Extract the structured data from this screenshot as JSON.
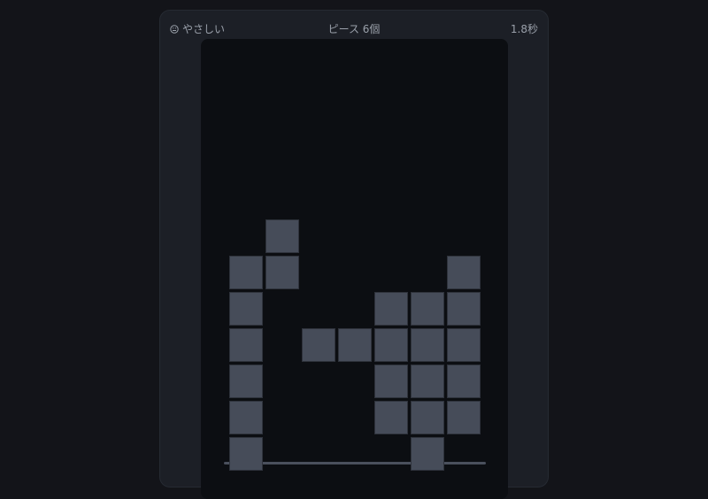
{
  "header": {
    "difficulty_icon": "neutral-face-icon",
    "difficulty_label": "やさしい",
    "piece_count_label": "ピース 6個",
    "timer_label": "1.8秒"
  },
  "colors": {
    "page_background": "#131419",
    "panel_background": "#1c1f26",
    "board_background": "#0c0e12",
    "block": "#464c59",
    "floor_line": "#4a505c",
    "text": "#9aa0aa"
  },
  "board": {
    "filled_cells": [
      [
        1,
        0
      ],
      [
        0,
        1
      ],
      [
        1,
        1
      ],
      [
        6,
        1
      ],
      [
        0,
        2
      ],
      [
        4,
        2
      ],
      [
        5,
        2
      ],
      [
        6,
        2
      ],
      [
        0,
        3
      ],
      [
        2,
        3
      ],
      [
        3,
        3
      ],
      [
        4,
        3
      ],
      [
        5,
        3
      ],
      [
        6,
        3
      ],
      [
        0,
        4
      ],
      [
        4,
        4
      ],
      [
        5,
        4
      ],
      [
        6,
        4
      ],
      [
        0,
        5
      ],
      [
        4,
        5
      ],
      [
        5,
        5
      ],
      [
        6,
        5
      ],
      [
        0,
        6
      ],
      [
        5,
        6
      ]
    ]
  }
}
